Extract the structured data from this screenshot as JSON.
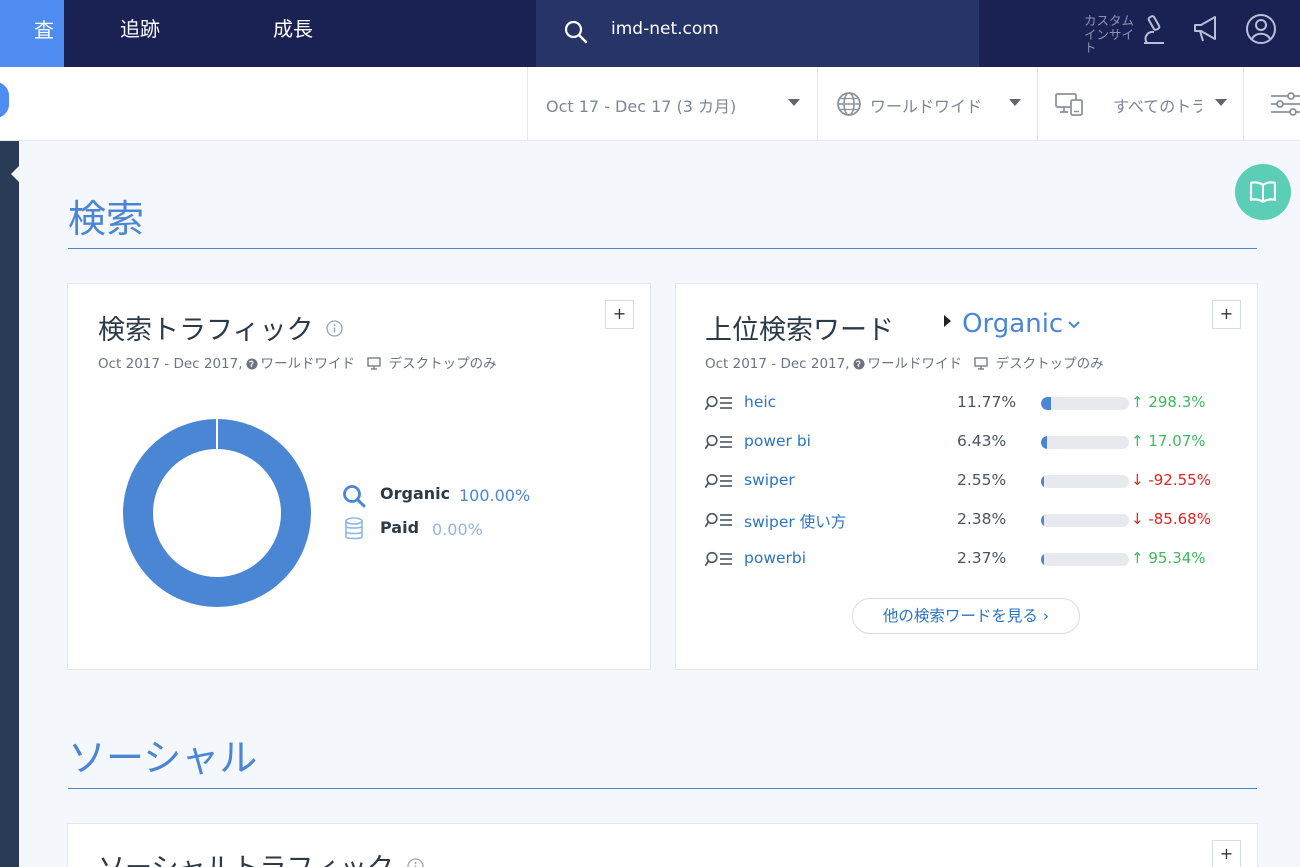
{
  "topnav": {
    "active_tab_label": "査",
    "tab_tracking": "追跡",
    "tab_growth": "成長",
    "search_value": "imd-net.com",
    "custom_insights": "カスタムインサイト"
  },
  "filters": {
    "date_range": "Oct 17 - Dec 17 (3 カ月)",
    "region": "ワールドワイド",
    "traffic": "すべてのトラフィック"
  },
  "search_section": {
    "title": "検索",
    "traffic_card": {
      "title": "検索トラフィック",
      "subtitle_date": "Oct 2017 - Dec 2017,",
      "subtitle_region": "ワールドワイド",
      "subtitle_device": "デスクトップのみ",
      "plus": "+",
      "legend": [
        {
          "label": "Organic",
          "value": "100.00%",
          "color": "#4a86d4"
        },
        {
          "label": "Paid",
          "value": "0.00%",
          "color": "#8fb6e8"
        }
      ]
    },
    "keywords_card": {
      "title": "上位検索ワード",
      "dropdown": "Organic",
      "subtitle_date": "Oct 2017 - Dec 2017,",
      "subtitle_region": "ワールドワイド",
      "subtitle_device": "デスクトップのみ",
      "plus": "+",
      "rows": [
        {
          "keyword": "heic",
          "share": "11.77%",
          "change": "↑ 298.3%",
          "dir": "up"
        },
        {
          "keyword": "power bi",
          "share": "6.43%",
          "change": "↑ 17.07%",
          "dir": "up"
        },
        {
          "keyword": "swiper",
          "share": "2.55%",
          "change": "↓ -92.55%",
          "dir": "down"
        },
        {
          "keyword": "swiper 使い方",
          "share": "2.38%",
          "change": "↓ -85.68%",
          "dir": "down"
        },
        {
          "keyword": "powerbi",
          "share": "2.37%",
          "change": "↑ 95.34%",
          "dir": "up"
        }
      ],
      "more_button": "他の検索ワードを見る ›"
    }
  },
  "social_section": {
    "title": "ソーシャル",
    "card_title": "ソーシャルトラフィック",
    "plus": "+"
  },
  "chart_data": {
    "type": "pie",
    "categories": [
      "Organic",
      "Paid"
    ],
    "values": [
      100.0,
      0.0
    ],
    "title": "",
    "donut": true
  }
}
